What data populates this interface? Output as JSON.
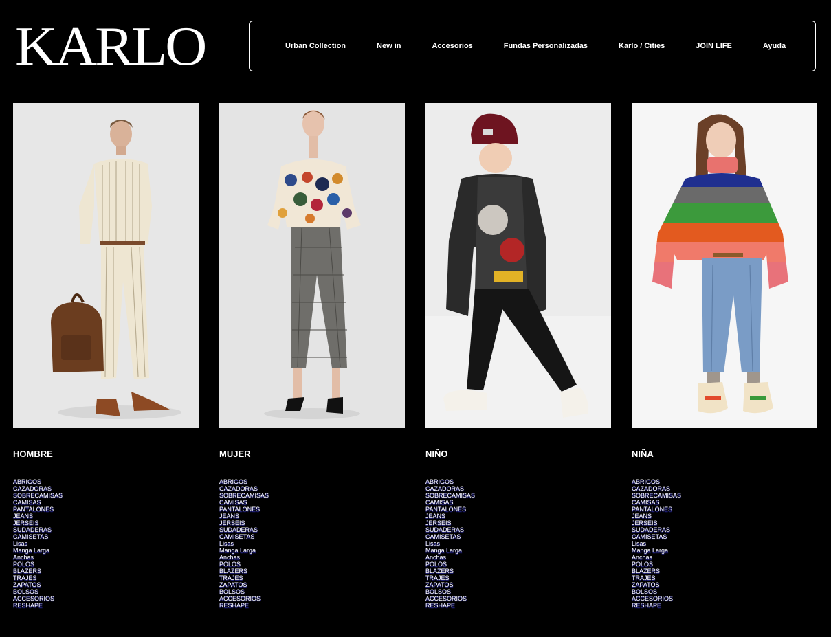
{
  "brand": {
    "logo_text": "KARLO"
  },
  "nav": {
    "items": [
      {
        "label": "Urban Collection"
      },
      {
        "label": "New in"
      },
      {
        "label": "Accesorios"
      },
      {
        "label": "Fundas Personalizadas"
      },
      {
        "label": "Karlo / Cities"
      },
      {
        "label": "JOIN LIFE"
      },
      {
        "label": "Ayuda"
      }
    ]
  },
  "categories": [
    {
      "title": "HOMBRE",
      "links": [
        "ABRIGOS",
        "CAZADORAS",
        "SOBRECAMISAS",
        "CAMISAS",
        "PANTALONES",
        "JEANS",
        "JERSEIS",
        "SUDADERAS",
        "CAMISETAS",
        "Lisas",
        "Manga Larga",
        "Anchas",
        "POLOS",
        "BLAZERS",
        "TRAJES",
        "ZAPATOS",
        "BOLSOS",
        "ACCESORIOS",
        "RESHAPE"
      ]
    },
    {
      "title": "MUJER",
      "links": [
        "ABRIGOS",
        "CAZADORAS",
        "SOBRECAMISAS",
        "CAMISAS",
        "PANTALONES",
        "JEANS",
        "JERSEIS",
        "SUDADERAS",
        "CAMISETAS",
        "Lisas",
        "Manga Larga",
        "Anchas",
        "POLOS",
        "BLAZERS",
        "TRAJES",
        "ZAPATOS",
        "BOLSOS",
        "ACCESORIOS",
        "RESHAPE"
      ]
    },
    {
      "title": "NIÑO",
      "links": [
        "ABRIGOS",
        "CAZADORAS",
        "SOBRECAMISAS",
        "CAMISAS",
        "PANTALONES",
        "JEANS",
        "JERSEIS",
        "SUDADERAS",
        "CAMISETAS",
        "Lisas",
        "Manga Larga",
        "Anchas",
        "POLOS",
        "BLAZERS",
        "TRAJES",
        "ZAPATOS",
        "BOLSOS",
        "ACCESORIOS",
        "RESHAPE"
      ]
    },
    {
      "title": "NIÑA",
      "links": [
        "ABRIGOS",
        "CAZADORAS",
        "SOBRECAMISAS",
        "CAMISAS",
        "PANTALONES",
        "JEANS",
        "JERSEIS",
        "SUDADERAS",
        "CAMISETAS",
        "Lisas",
        "Manga Larga",
        "Anchas",
        "POLOS",
        "BLAZERS",
        "TRAJES",
        "ZAPATOS",
        "BOLSOS",
        "ACCESORIOS",
        "RESHAPE"
      ]
    }
  ],
  "colors": {
    "background": "#000000",
    "text": "#ffffff",
    "link_shadow": "#3a3acf",
    "photo_bg": "#e6e6e6"
  }
}
